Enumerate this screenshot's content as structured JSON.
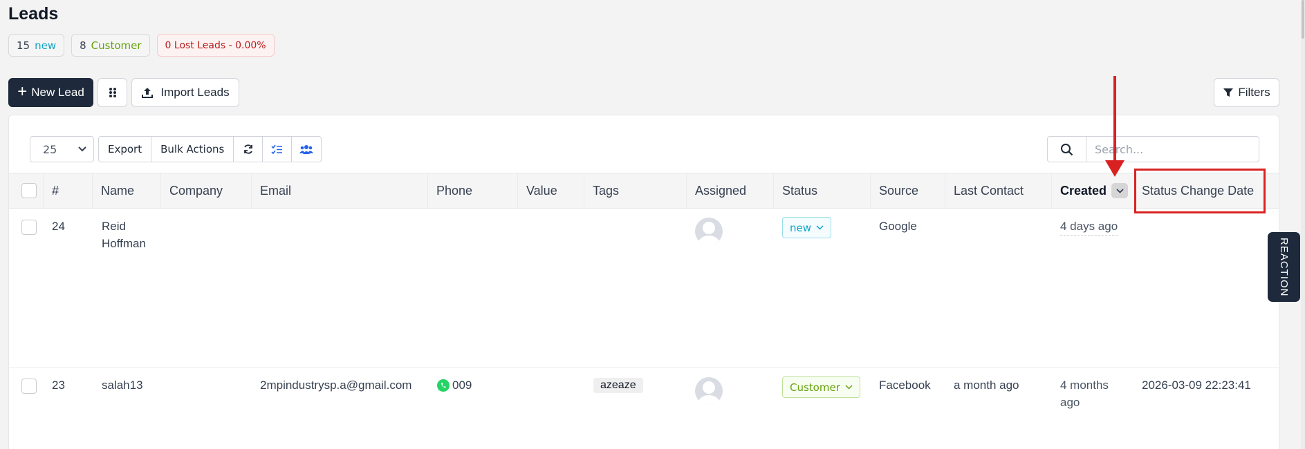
{
  "page": {
    "title": "Leads"
  },
  "stats": {
    "new_count": "15",
    "new_label": "new",
    "customer_count": "8",
    "customer_label": "Customer",
    "lost_label": "0 Lost Leads - 0.00%"
  },
  "toolbar": {
    "new_lead": "New Lead",
    "import_leads": "Import Leads",
    "filters": "Filters"
  },
  "table_controls": {
    "per_page": "25",
    "export": "Export",
    "bulk_actions": "Bulk Actions",
    "search_placeholder": "Search..."
  },
  "columns": {
    "num": "#",
    "name": "Name",
    "company": "Company",
    "email": "Email",
    "phone": "Phone",
    "value": "Value",
    "tags": "Tags",
    "assigned": "Assigned",
    "status": "Status",
    "source": "Source",
    "last_contact": "Last Contact",
    "created": "Created",
    "status_change_date": "Status Change Date"
  },
  "rows": [
    {
      "id": "24",
      "name": "Reid Hoffman",
      "company": "",
      "email": "",
      "phone": "",
      "value": "",
      "tag": "",
      "status": "new",
      "source": "Google",
      "last_contact": "",
      "created": "4 days ago",
      "status_change_date": ""
    },
    {
      "id": "23",
      "name": "salah13",
      "company": "",
      "email": "2mpindustrysp.a@gmail.com",
      "phone": "009",
      "value": "",
      "tag": "azeaze",
      "status": "Customer",
      "source": "Facebook",
      "last_contact": "a month ago",
      "created": "4 months ago",
      "status_change_date": "2026-03-09 22:23:41"
    }
  ],
  "side_tab": {
    "label": "REACTION"
  },
  "colors": {
    "primary": "#1e2a3b",
    "new": "#0ea5c6",
    "customer": "#65a30d",
    "lost": "#b91c1c",
    "annotation": "#d92121",
    "whatsapp": "#25d366"
  },
  "icons": [
    "plus-icon",
    "grid-icon",
    "upload-icon",
    "filter-icon",
    "chevron-down-icon",
    "refresh-icon",
    "checklist-icon",
    "users-icon",
    "search-icon",
    "whatsapp-icon"
  ]
}
